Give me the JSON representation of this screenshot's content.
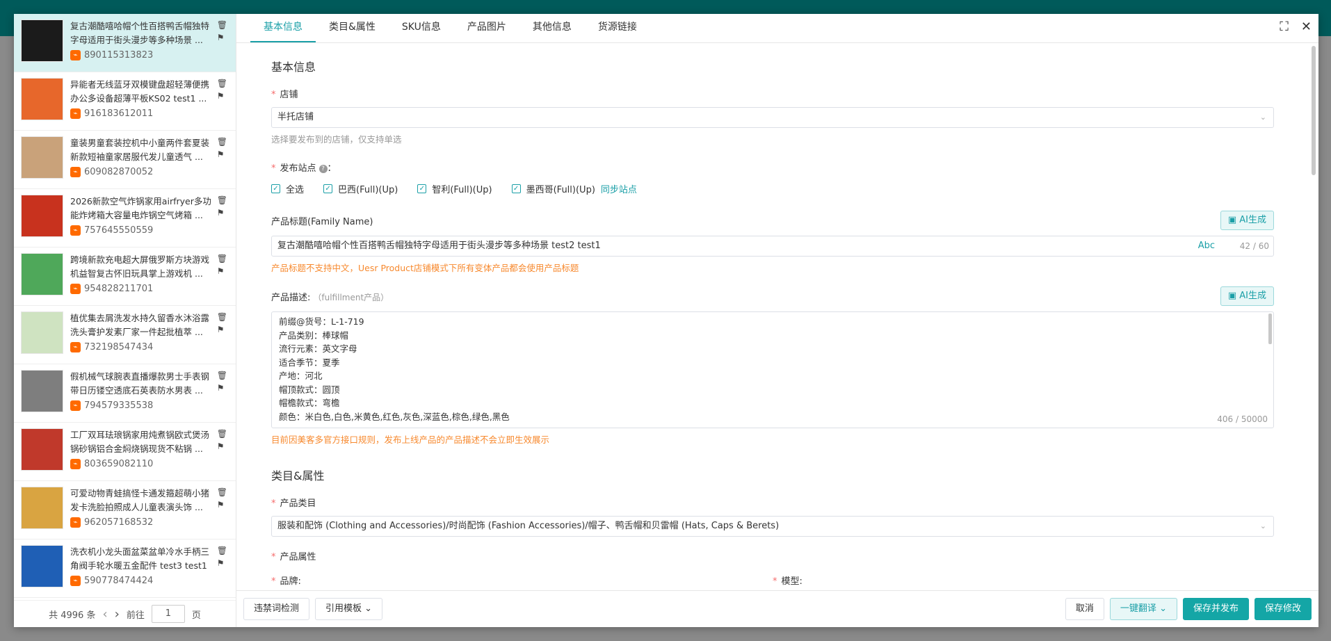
{
  "sidebar": {
    "items": [
      {
        "title": "复古潮酷嘻哈帽个性百搭鸭舌帽独特字母适用于街头漫步等多种场景 ...",
        "id": "890115313823",
        "thumb": "#1b1b1b"
      },
      {
        "title": "异能者无线蓝牙双模键盘超轻薄便携办公多设备超薄平板KS02 test1 ...",
        "id": "916183612011",
        "thumb": "#e7672b"
      },
      {
        "title": "童装男童套装控机中小童两件套夏装新款短袖童家居服代发儿童透气 ...",
        "id": "609082870052",
        "thumb": "#c9a27a"
      },
      {
        "title": "2026新款空气炸锅家用airfryer多功能炸烤箱大容量电炸锅空气烤箱 ...",
        "id": "757645550559",
        "thumb": "#c8321e"
      },
      {
        "title": "跨境新款充电超大屏俄罗斯方块游戏机益智复古怀旧玩具掌上游戏机 ...",
        "id": "954828211701",
        "thumb": "#4fa85a"
      },
      {
        "title": "植优集去屑洗发水持久留香水沐浴露洗头膏护发素厂家一件起批植萃 ...",
        "id": "732198547434",
        "thumb": "#cfe3c1"
      },
      {
        "title": "假机械气球腕表直播爆款男士手表钢带日历镂空透底石英表防水男表 ...",
        "id": "794579335538",
        "thumb": "#7e7e7e"
      },
      {
        "title": "工厂双耳珐琅锅家用炖煮锅欧式煲汤锅砂锅铝合金焖烧锅现货不粘锅 ...",
        "id": "803659082110",
        "thumb": "#c0392b"
      },
      {
        "title": "可爱动物青蛙搞怪卡通发箍超萌小猪发卡洗脸拍照成人儿童表演头饰 ...",
        "id": "962057168532",
        "thumb": "#d9a441"
      },
      {
        "title": "洗衣机小龙头面盆菜盆单冷水手柄三角阀手轮水暖五金配件 test3 test1",
        "id": "590778474424",
        "thumb": "#1f5fb5"
      }
    ],
    "pager": {
      "total": "共 4996 条",
      "prev": "‹",
      "next": "›",
      "goto_label": "前往",
      "page": "1",
      "page_unit": "页"
    }
  },
  "tabs": [
    "基本信息",
    "类目&属性",
    "SKU信息",
    "产品图片",
    "其他信息",
    "货源链接"
  ],
  "icons": {
    "fullscreen": "⛶",
    "close": "✕",
    "delete": "🗑",
    "flag": "⚑",
    "arrow": "⌄",
    "help": "?",
    "check": "✓"
  },
  "basic": {
    "section_title": "基本信息",
    "store_label": "店铺",
    "store_value": "半托店铺",
    "store_hint": "选择要发布到的店铺，仅支持单选",
    "site_label": "发布站点",
    "site_colon": "：",
    "sites": [
      "全选",
      "巴西(Full)(Up)",
      "智利(Full)(Up)",
      "墨西哥(Full)(Up)"
    ],
    "sync_sites": "同步站点",
    "title_label": "产品标题(Family Name)",
    "ai_label": "AI生成",
    "title_value": "复古潮酷嘻哈帽个性百搭鸭舌帽独特字母适用于街头漫步等多种场景 test2 test1",
    "abc": "Abc",
    "title_count": "42 / 60",
    "title_warn": "产品标题不支持中文，Uesr Product店铺模式下所有变体产品都会使用产品标题",
    "desc_label": "产品描述:",
    "desc_sub": "（fulfillment产品）",
    "desc_lines": [
      "前缀@货号：L-1-719",
      "产品类别：棒球帽",
      "流行元素：英文字母",
      "适合季节：夏季",
      "产地：河北",
      "帽顶款式：圆顶",
      "帽檐款式：弯檐",
      "颜色：米白色,白色,米黄色,红色,灰色,深蓝色,棕色,绿色,黑色"
    ],
    "desc_count": "406 / 50000",
    "desc_warn": "目前因美客多官方接口规则，发布上线产品的产品描述不会立即生效展示"
  },
  "category": {
    "section_title": "类目&属性",
    "cat_label": "产品类目",
    "cat_value": "服装和配饰 (Clothing and Accessories)/时尚配饰 (Fashion Accessories)/帽子、鸭舌帽和贝雷帽 (Hats, Caps & Berets)",
    "attr_label": "产品属性",
    "brand_label": "品牌:",
    "model_label": "模型:"
  },
  "footer": {
    "check_words": "违禁词检测",
    "template": "引用模板",
    "cancel": "取消",
    "translate": "一键翻译",
    "save_publish": "保存并发布",
    "save": "保存修改"
  }
}
